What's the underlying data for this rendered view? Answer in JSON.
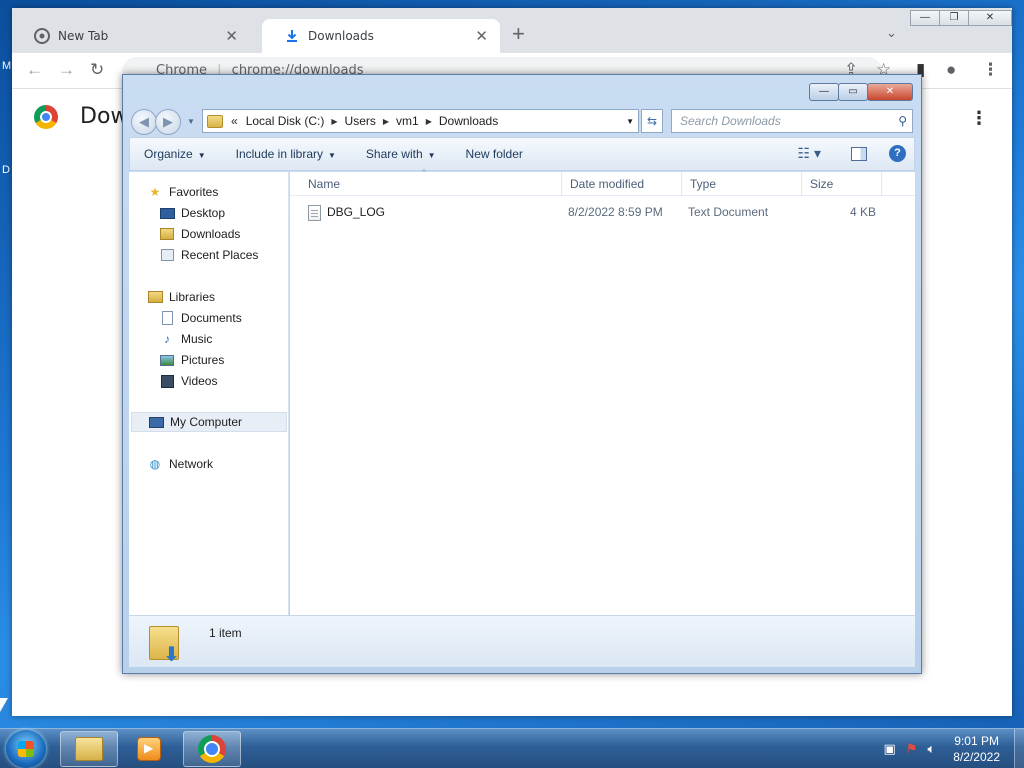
{
  "desktop": {
    "letters": [
      "M",
      "D"
    ]
  },
  "chrome": {
    "tabs": [
      {
        "title": "New Tab",
        "icon": "chrome-icon"
      },
      {
        "title": "Downloads",
        "icon": "download-icon"
      }
    ],
    "omnibox": {
      "site_label": "Chrome",
      "url": "chrome://downloads"
    },
    "page_title": "Downloads",
    "window_buttons": [
      "minimize",
      "restore",
      "close"
    ]
  },
  "explorer": {
    "address": {
      "overflow": "«",
      "crumbs": [
        "Local Disk (C:)",
        "Users",
        "vm1",
        "Downloads"
      ]
    },
    "search_placeholder": "Search Downloads",
    "commands": [
      "Organize",
      "Include in library",
      "Share with",
      "New folder"
    ],
    "nav": {
      "favorites_label": "Favorites",
      "favorites": [
        "Desktop",
        "Downloads",
        "Recent Places"
      ],
      "libraries_label": "Libraries",
      "libraries": [
        "Documents",
        "Music",
        "Pictures",
        "Videos"
      ],
      "computer_label": "My Computer",
      "network_label": "Network"
    },
    "columns": [
      "Name",
      "Date modified",
      "Type",
      "Size"
    ],
    "files": [
      {
        "name": "DBG_LOG",
        "date_modified": "8/2/2022 8:59 PM",
        "type": "Text Document",
        "size": "4 KB"
      }
    ],
    "status_count": "1 item"
  },
  "taskbar": {
    "apps": [
      "Windows Explorer",
      "Windows Media Player",
      "Google Chrome"
    ],
    "clock_time": "9:01 PM",
    "clock_date": "8/2/2022"
  },
  "colors": {
    "chrome_tabstrip": "#dee1e6",
    "explorer_frame": "#c9dcf2",
    "taskbar": "#2e5f97"
  }
}
